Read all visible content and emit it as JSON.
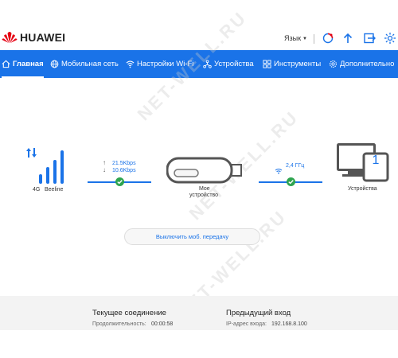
{
  "header": {
    "brand": "HUAWEI",
    "language_label": "Язык",
    "icons": [
      "update-icon",
      "upload-icon",
      "logout-icon",
      "brightness-icon"
    ]
  },
  "nav": {
    "items": [
      {
        "label": "Главная",
        "icon": "home-icon",
        "active": true
      },
      {
        "label": "Мобильная сеть",
        "icon": "globe-icon",
        "active": false
      },
      {
        "label": "Настройки Wi-Fi",
        "icon": "wifi-icon",
        "active": false
      },
      {
        "label": "Устройства",
        "icon": "devices-icon",
        "active": false
      },
      {
        "label": "Инструменты",
        "icon": "tools-icon",
        "active": false
      },
      {
        "label": "Дополнительно",
        "icon": "gear-icon",
        "active": false
      }
    ]
  },
  "watermark": "NET-WELL.RU",
  "status": {
    "network_type": "4G",
    "operator": "Beeline",
    "upload_speed": "21.5Kbps",
    "download_speed": "10.6Kbps",
    "device_label_line1": "Мое",
    "device_label_line2": "устройство",
    "wifi_band": "2,4 ГГц",
    "connected_devices_count": "1",
    "devices_label": "Устройства",
    "signal_level": 4,
    "signal_max": 4
  },
  "action": {
    "disable_mobile_data_label": "Выключить моб. передачу"
  },
  "footer": {
    "current": {
      "title": "Текущее соединение",
      "duration_label": "Продолжительность:",
      "duration_value": "00:00:58"
    },
    "previous": {
      "title": "Предыдущий вход",
      "ip_label": "IP-адрес входа:",
      "ip_value": "192.168.8.100"
    }
  },
  "colors": {
    "accent": "#1a73e8",
    "success": "#2ea44f",
    "brand_red": "#e60012"
  }
}
